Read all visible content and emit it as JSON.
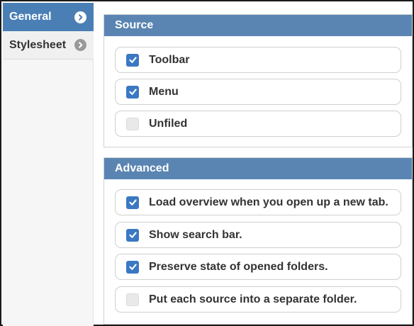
{
  "sidebar": {
    "items": [
      {
        "label": "General",
        "active": true
      },
      {
        "label": "Stylesheet",
        "active": false
      }
    ]
  },
  "sections": [
    {
      "title": "Source",
      "options": [
        {
          "label": "Toolbar",
          "checked": true
        },
        {
          "label": "Menu",
          "checked": true
        },
        {
          "label": "Unfiled",
          "checked": false
        }
      ]
    },
    {
      "title": "Advanced",
      "options": [
        {
          "label": "Load overview when you open up a new tab.",
          "checked": true
        },
        {
          "label": "Show search bar.",
          "checked": true
        },
        {
          "label": "Preserve state of opened folders.",
          "checked": true
        },
        {
          "label": "Put each source into a separate folder.",
          "checked": false
        }
      ]
    }
  ],
  "colors": {
    "header": "#5a85b2",
    "active_nav": "#4a7fb5",
    "checkbox_on": "#3b78c2"
  }
}
